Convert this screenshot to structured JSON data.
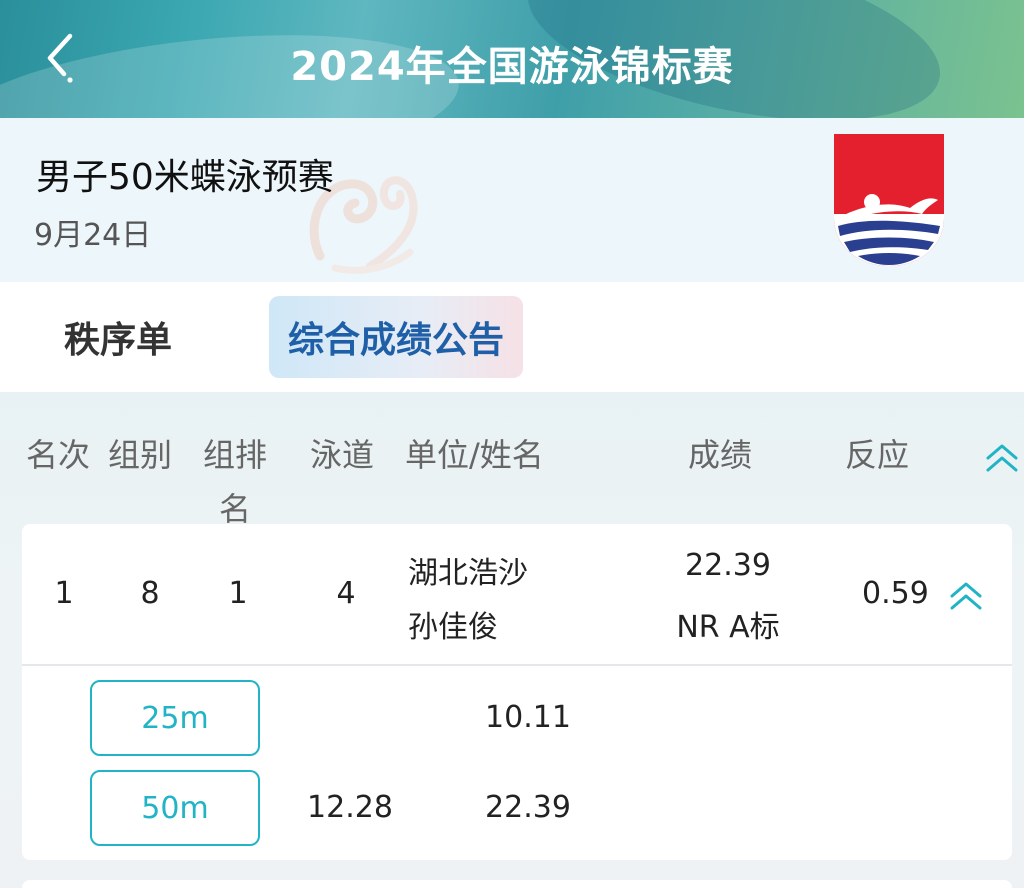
{
  "header": {
    "title": "2024年全国游泳锦标赛"
  },
  "event": {
    "name": "男子50米蝶泳预赛",
    "date": "9月24日"
  },
  "tabs": [
    {
      "label": "秩序单",
      "active": false
    },
    {
      "label": "综合成绩公告",
      "active": true
    }
  ],
  "table": {
    "columns": {
      "rank": "名次",
      "group": "组别",
      "group_rank_line1": "组排",
      "group_rank_line2": "名",
      "lane": "泳道",
      "unit_name": "单位/姓名",
      "result": "成绩",
      "reaction": "反应"
    },
    "rows": [
      {
        "rank": "1",
        "group": "8",
        "group_rank": "1",
        "lane": "4",
        "unit": "湖北浩沙",
        "name": "孙佳俊",
        "result": "22.39",
        "note": "NR A标",
        "reaction": "0.59",
        "splits": [
          {
            "label": "25m",
            "split": "",
            "cumulative": "10.11"
          },
          {
            "label": "50m",
            "split": "12.28",
            "cumulative": "22.39"
          }
        ]
      }
    ]
  },
  "icons": {
    "back": "chevron-left-icon",
    "collapse_all": "double-chevron-up-icon",
    "collapse_row": "double-chevron-up-icon",
    "logo": "swimmer-logo"
  },
  "colors": {
    "accent": "#21b3c6",
    "active_tab_text": "#1f5fa8",
    "logo_red": "#e5202e",
    "logo_blue": "#2a3f8f"
  }
}
